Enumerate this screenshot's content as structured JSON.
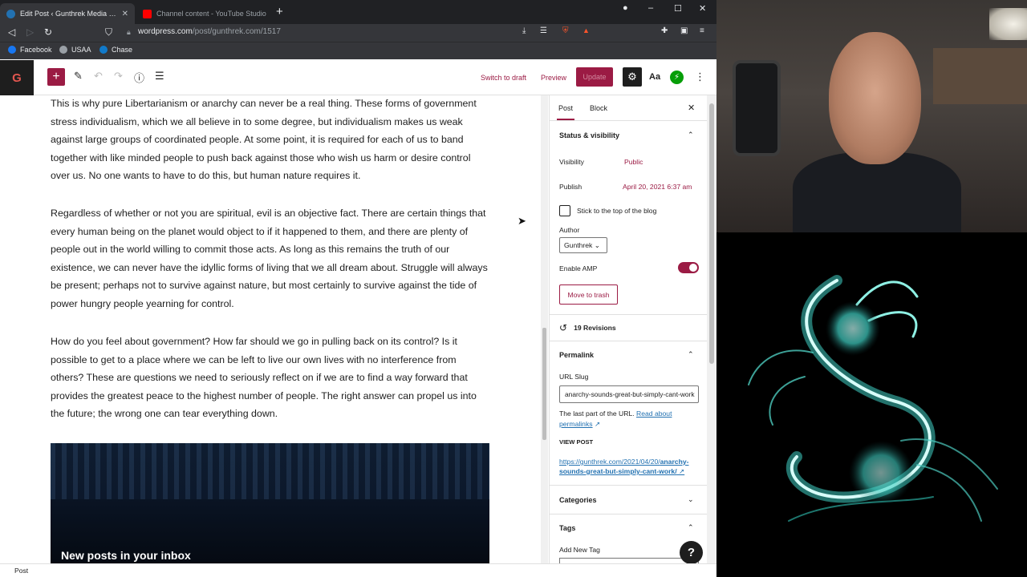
{
  "browser": {
    "tabs": [
      {
        "title": "Edit Post ‹ Gunthrek Media — W",
        "active": true,
        "favicon_color": "#2271b1"
      },
      {
        "title": "Channel content - YouTube Studio",
        "active": false,
        "favicon_color": "#ff0000"
      }
    ],
    "new_tab_glyph": "+",
    "url_host": "wordpress.com",
    "url_path": "/post/gunthrek.com/1517",
    "bookmarks": [
      {
        "label": "Facebook",
        "icon_color": "#1877f2"
      },
      {
        "label": "USAA",
        "icon_color": "#9aa0a6"
      },
      {
        "label": "Chase",
        "icon_color": "#117aca"
      }
    ]
  },
  "toolbar": {
    "logo_letter": "G",
    "switch_to_draft": "Switch to draft",
    "preview": "Preview",
    "update": "Update",
    "aa": "Aa",
    "inserter_glyph": "+",
    "accent": "#9b1b44"
  },
  "editor": {
    "paragraphs": [
      "This is why pure Libertarianism or anarchy can never be a real thing.  These forms of government stress individualism, which we all believe in to some degree, but individualism makes us weak against large groups of coordinated people.  At some point, it is required for each of us to band together with like minded people to push back against those who wish us harm or desire control over us.  No one wants to have to do this, but human nature requires it.",
      "Regardless of whether or not you are spiritual, evil is an objective fact.  There are certain things that every human being on the planet would object to if it happened to them, and there are plenty of people out in the world willing to commit those acts.  As long as this remains the truth of our existence, we can never have the idyllic forms of living that we all dream about.  Struggle will always be present; perhaps not to survive against nature, but most certainly to survive against the tide of power hungry people yearning for control.",
      "How do you feel about government?  How far should we go in pulling back on its control?  Is it possible to get to a place where we can be left to live our own lives with no interference from others?  These are questions we need to seriously reflect on if we are to find a way forward that provides the greatest peace to the highest number of people.  The right answer can propel us into the future; the wrong one can tear everything down."
    ],
    "banner_title": "New posts in your inbox"
  },
  "sidebar": {
    "tab_post": "Post",
    "tab_block": "Block",
    "status_title": "Status & visibility",
    "visibility_label": "Visibility",
    "visibility_value": "Public",
    "publish_label": "Publish",
    "publish_value": "April 20, 2021 6:37 am",
    "sticky_label": "Stick to the top of the blog",
    "author_label": "Author",
    "author_value": "Gunthrek",
    "amp_label": "Enable AMP",
    "trash_label": "Move to trash",
    "revisions": "19 Revisions",
    "permalink_title": "Permalink",
    "slug_label": "URL Slug",
    "slug_value": "anarchy-sounds-great-but-simply-cant-work",
    "help_text": "The last part of the URL.",
    "read_about": "Read about permalinks",
    "view_post": "VIEW POST",
    "post_url_prefix": "https://gunthrek.com/2021/04/20/",
    "post_url_slug": "anarchy-sounds-great-but-simply-cant-work/",
    "categories_title": "Categories",
    "tags_title": "Tags",
    "add_tag_label": "Add New Tag"
  },
  "footer": {
    "breadcrumb": "Post"
  },
  "help_glyph": "?"
}
